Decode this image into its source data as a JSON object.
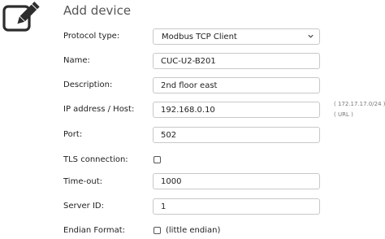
{
  "header": {
    "title": "Add device",
    "icon": "pencil-edit-icon"
  },
  "form": {
    "protocol": {
      "label": "Protocol type:",
      "value": "Modbus TCP Client",
      "icon": "chevron-down-icon"
    },
    "name": {
      "label": "Name:",
      "value": "CUC-U2-B201"
    },
    "description": {
      "label": "Description:",
      "value": "2nd floor east"
    },
    "ip": {
      "label": "IP address / Host:",
      "value": "192.168.0.10",
      "hint1": "( 172.17.17.0/24 )",
      "hint2": "( URL )"
    },
    "port": {
      "label": "Port:",
      "value": "502"
    },
    "tls": {
      "label": "TLS connection:",
      "checked": false
    },
    "timeout": {
      "label": "Time-out:",
      "value": "1000"
    },
    "server_id": {
      "label": "Server ID:",
      "value": "1"
    },
    "endian": {
      "label": "Endian Format:",
      "checked": false,
      "option_label": "(little endian)"
    }
  }
}
